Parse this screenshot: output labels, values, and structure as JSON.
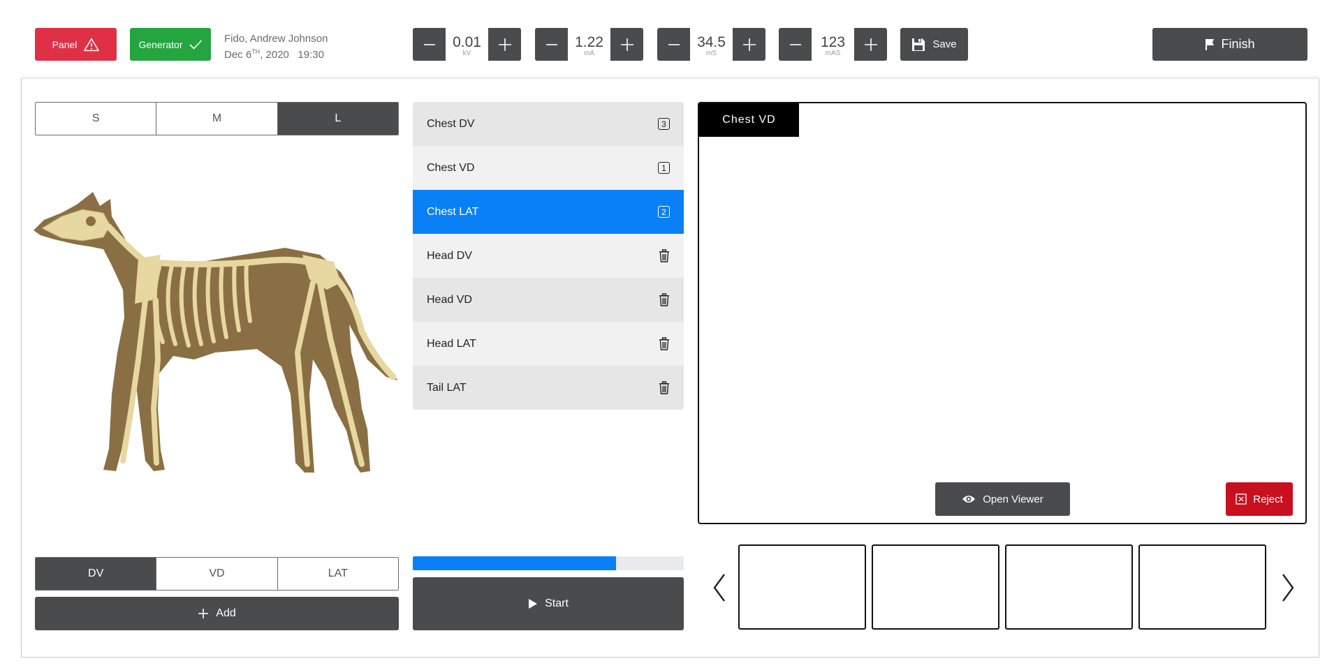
{
  "header": {
    "panel_label": "Panel",
    "generator_label": "Generator",
    "patient_name": "Fido, Andrew Johnson",
    "date_day": "Dec 6",
    "date_suffix": "TH",
    "date_rest": ", 2020",
    "time": "19:30",
    "panel_color": "#e03046",
    "generator_color": "#24a540"
  },
  "steppers": [
    {
      "value": "0.01",
      "unit": "kV"
    },
    {
      "value": "1.22",
      "unit": "mA"
    },
    {
      "value": "34.5",
      "unit": "mS"
    },
    {
      "value": "123",
      "unit": "mAS"
    }
  ],
  "toolbar": {
    "save_label": "Save",
    "finish_label": "Finish"
  },
  "size_selector": {
    "options": [
      "S",
      "M",
      "L"
    ],
    "selected": "L"
  },
  "projection_selector": {
    "options": [
      "DV",
      "VD",
      "LAT"
    ],
    "selected": "DV"
  },
  "add_label": "Add",
  "views": [
    {
      "label": "Chest DV",
      "badge": "3",
      "icon": "count-badge"
    },
    {
      "label": "Chest VD",
      "badge": "1",
      "icon": "count-badge"
    },
    {
      "label": "Chest LAT",
      "badge": "2",
      "icon": "count-badge",
      "active": true
    },
    {
      "label": "Head DV",
      "icon": "trash-icon"
    },
    {
      "label": "Head VD",
      "icon": "trash-icon"
    },
    {
      "label": "Head LAT",
      "icon": "trash-icon"
    },
    {
      "label": "Tail LAT",
      "icon": "trash-icon"
    }
  ],
  "progress": {
    "fraction": 0.75,
    "color": "#0a80f6"
  },
  "start_label": "Start",
  "viewer": {
    "tab_label": "Chest VD",
    "open_viewer_label": "Open Viewer",
    "reject_label": "Reject",
    "reject_color": "#c8101f"
  },
  "thumbnails": {
    "count": 4
  },
  "accent_color": "#0a80f6",
  "dark_color": "#4a4b4d"
}
